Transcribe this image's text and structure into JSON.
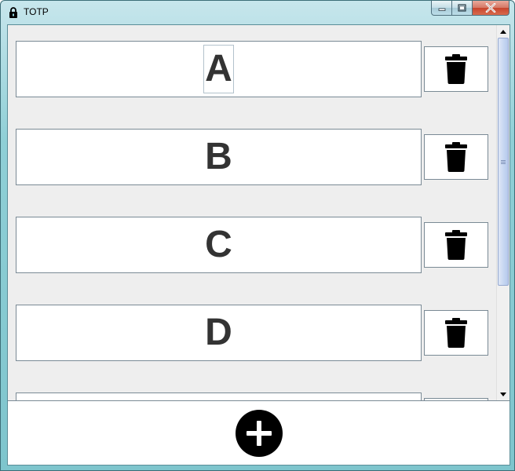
{
  "window": {
    "title": "TOTP",
    "icon": "lock-icon",
    "caption_buttons": [
      "minimize-icon",
      "maximize-icon",
      "close-icon"
    ]
  },
  "accounts": [
    {
      "label": "A",
      "delete_icon": "trash-icon"
    },
    {
      "label": "B",
      "delete_icon": "trash-icon"
    },
    {
      "label": "C",
      "delete_icon": "trash-icon"
    },
    {
      "label": "D",
      "delete_icon": "trash-icon"
    },
    {
      "label": "",
      "delete_icon": "trash-icon"
    }
  ],
  "footer": {
    "add_icon": "plus-circle-icon"
  },
  "colors": {
    "label_text": "#333333",
    "icon_black": "#000000",
    "client_bg": "#eeeeee"
  }
}
